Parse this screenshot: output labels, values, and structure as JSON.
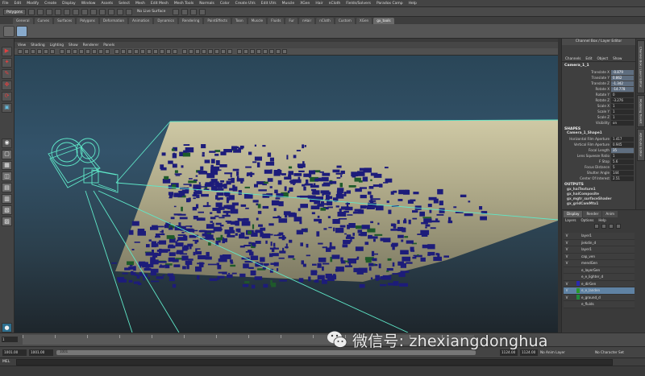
{
  "menubar": {
    "items": [
      "File",
      "Edit",
      "Modify",
      "Create",
      "Display",
      "Window",
      "Assets",
      "Select",
      "Mesh",
      "Edit Mesh",
      "Mesh Tools",
      "Normals",
      "Color",
      "Create UVs",
      "Edit UVs",
      "Muscle",
      "XGen",
      "Hair",
      "nCloth",
      "Fields/Solvers",
      "Paradox Camp",
      "Help"
    ]
  },
  "statusline": {
    "mode": "Polygons",
    "live_surface": "No Live Surface"
  },
  "shelf": {
    "tabs": [
      "General",
      "Curves",
      "Surfaces",
      "Polygons",
      "Deformation",
      "Animation",
      "Dynamics",
      "Rendering",
      "PaintEffects",
      "Toon",
      "Muscle",
      "Fluids",
      "Fur",
      "nHair",
      "nCloth",
      "Custom",
      "XGen",
      "gx_tools"
    ],
    "active_tab": "gx_tools"
  },
  "viewport": {
    "menu": [
      "View",
      "Shading",
      "Lighting",
      "Show",
      "Renderer",
      "Panels"
    ],
    "colors": {
      "frustum": "#5fe8c8",
      "ground_plane": "#b9b392",
      "buildings": "#1d1c7a",
      "vegetation": "#1e5a2a"
    }
  },
  "channel_box": {
    "title": "Channel Box / Layer Editor",
    "menu": [
      "Channels",
      "Edit",
      "Object",
      "Show"
    ],
    "object_name": "Camera_1_1",
    "attributes": [
      {
        "name": "Translate X",
        "value": "-0.879"
      },
      {
        "name": "Translate Y",
        "value": "0.862"
      },
      {
        "name": "Translate Z",
        "value": "-1.342"
      },
      {
        "name": "Rotate X",
        "value": "-14.778"
      },
      {
        "name": "Rotate Y",
        "value": "0"
      },
      {
        "name": "Rotate Z",
        "value": "-3.276"
      },
      {
        "name": "Scale X",
        "value": "1"
      },
      {
        "name": "Scale Y",
        "value": "1"
      },
      {
        "name": "Scale Z",
        "value": "1"
      },
      {
        "name": "Visibility",
        "value": "on"
      }
    ],
    "shapes_label": "SHAPES",
    "shape_name": "Camera_1_Shape1",
    "shape_attributes": [
      {
        "name": "Horizontal Film Aperture",
        "value": "1.417"
      },
      {
        "name": "Vertical Film Aperture",
        "value": "0.945"
      },
      {
        "name": "Focal Length",
        "value": "35"
      },
      {
        "name": "Lens Squeeze Ratio",
        "value": "1"
      },
      {
        "name": "F Stop",
        "value": "5.6"
      },
      {
        "name": "Focus Distance",
        "value": "5"
      },
      {
        "name": "Shutter Angle",
        "value": "144"
      },
      {
        "name": "Center Of Interest",
        "value": "2.51"
      }
    ],
    "outputs_label": "OUTPUTS",
    "outputs": [
      "gx_haiTexture1",
      "gx_haiComposite",
      "gx_mgtr_surfaceShader",
      "gx_gridCamMtx1"
    ]
  },
  "side_tabs": [
    "Channel Box / Layer Editor",
    "Modeling Toolkit",
    "Attribute Editor"
  ],
  "layer_editor": {
    "tabs": [
      "Display",
      "Render",
      "Anim"
    ],
    "active_tab": "Display",
    "menu": [
      "Layers",
      "Options",
      "Help"
    ],
    "layers": [
      {
        "v": "V",
        "name": "layer1",
        "color": "",
        "selected": false
      },
      {
        "v": "V",
        "name": "jiekdin_d",
        "color": "",
        "selected": false
      },
      {
        "v": "V",
        "name": "layer1",
        "color": "",
        "selected": false
      },
      {
        "v": "V",
        "name": "cap_ven",
        "color": "",
        "selected": false
      },
      {
        "v": "V",
        "name": "mendGen",
        "color": "",
        "selected": false
      },
      {
        "v": "",
        "name": "e_layerGen",
        "color": "",
        "selected": false
      },
      {
        "v": "",
        "name": "e_e_lighter_d",
        "color": "",
        "selected": false
      },
      {
        "v": "V",
        "name": "e_dirGen",
        "color": "#2a2ab0",
        "selected": false
      },
      {
        "v": "V",
        "name": "e_e_landen",
        "color": "#2a9a2a",
        "selected": true
      },
      {
        "v": "V",
        "name": "e_ground_d",
        "color": "#1f8a3a",
        "selected": false
      },
      {
        "v": "",
        "name": "e_fluids",
        "color": "",
        "selected": false
      }
    ]
  },
  "time": {
    "start": "1",
    "ticks": [
      "",
      "",
      "",
      "",
      "",
      "",
      "",
      "",
      "",
      "",
      "",
      "",
      "",
      ""
    ],
    "range_start": "1001.00",
    "range_inner_start": "1001.00",
    "range_inner_end": "1124.00",
    "range_end": "1124.00",
    "current": "1001",
    "anim_layer": "No Anim Layer",
    "char_set": "No Character Set"
  },
  "cmdline": {
    "label": "MEL"
  },
  "watermark": {
    "text": "微信号: zhexiangdonghua"
  }
}
